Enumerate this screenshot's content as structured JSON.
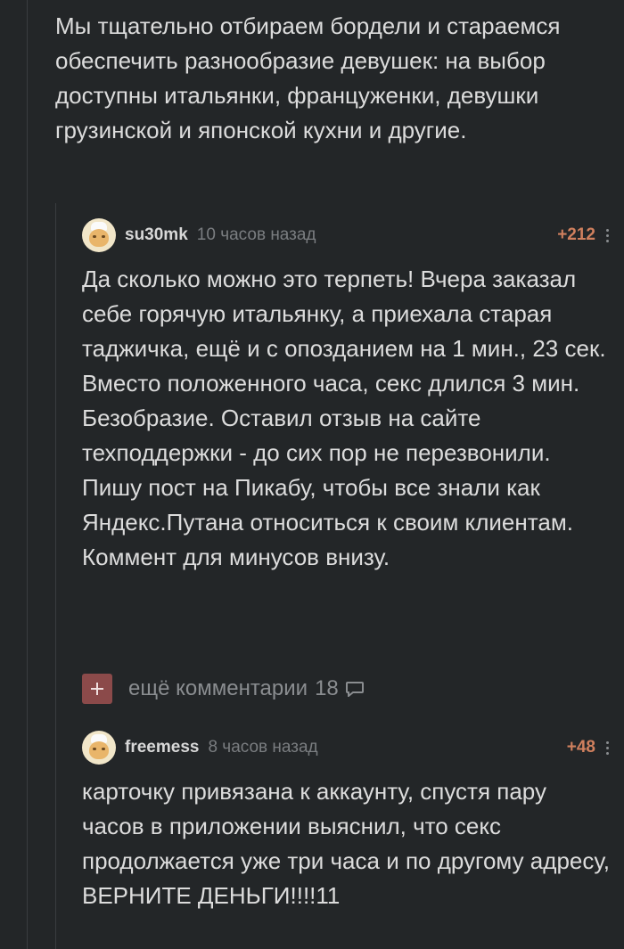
{
  "parent_text": "Мы тщательно отбираем бордели и стараемся обеспечить разнообразие девушек: на выбор доступны итальянки, француженки, девушки грузинской и японской кухни и другие.",
  "comments": [
    {
      "username": "su30mk",
      "time": "10 часов назад",
      "rating": "+212",
      "text": "Да сколько можно это терпеть! Вчера заказал себе горячую итальянку, а приехала старая таджичка, ещё и с опозданием на 1 мин., 23 сек. Вместо положенного часа, секс длился 3 мин. Безобразие. Оставил отзыв на сайте техподдержки - до сих пор не перезвонили. Пишу пост на Пикабу, чтобы все знали как Яндекс.Путана относиться к своим клиентам. Коммент для минусов внизу."
    },
    {
      "username": "freemess",
      "time": "8 часов назад",
      "rating": "+48",
      "text": "карточку привязана к аккаунту, спустя пару часов в приложении выяснил, что секс продолжается уже три часа и по другому адресу, ВЕРНИТЕ ДЕНЬГИ!!!!11"
    }
  ],
  "more_comments": {
    "label": "ещё комментарии",
    "count": "18",
    "icon": "comment-bubble-icon"
  },
  "colors": {
    "background": "#232628",
    "rating": "#d0805e",
    "plus_button": "#8b4a4a"
  }
}
